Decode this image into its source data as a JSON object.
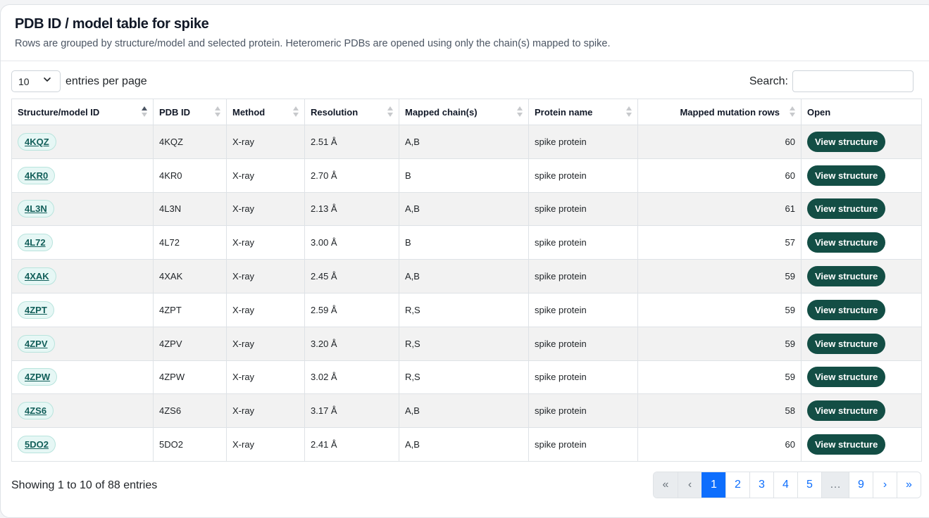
{
  "header": {
    "title": "PDB ID / model table for spike",
    "subtitle": "Rows are grouped by structure/model and selected protein. Heteromeric PDBs are opened using only the chain(s) mapped to spike."
  },
  "controls": {
    "length_value": "10",
    "length_label": "entries per page",
    "search_label": "Search:",
    "search_value": ""
  },
  "table": {
    "columns": [
      "Structure/model ID",
      "PDB ID",
      "Method",
      "Resolution",
      "Mapped chain(s)",
      "Protein name",
      "Mapped mutation rows",
      "Open"
    ],
    "sorted_column": "Structure/model ID",
    "sort_direction": "ascending",
    "rows": [
      {
        "id": "4KQZ",
        "pdb": "4KQZ",
        "method": "X-ray",
        "resolution": "2.51 Å",
        "chains": "A,B",
        "protein": "spike protein",
        "rows": "60",
        "open": "View structure"
      },
      {
        "id": "4KR0",
        "pdb": "4KR0",
        "method": "X-ray",
        "resolution": "2.70 Å",
        "chains": "B",
        "protein": "spike protein",
        "rows": "60",
        "open": "View structure"
      },
      {
        "id": "4L3N",
        "pdb": "4L3N",
        "method": "X-ray",
        "resolution": "2.13 Å",
        "chains": "A,B",
        "protein": "spike protein",
        "rows": "61",
        "open": "View structure"
      },
      {
        "id": "4L72",
        "pdb": "4L72",
        "method": "X-ray",
        "resolution": "3.00 Å",
        "chains": "B",
        "protein": "spike protein",
        "rows": "57",
        "open": "View structure"
      },
      {
        "id": "4XAK",
        "pdb": "4XAK",
        "method": "X-ray",
        "resolution": "2.45 Å",
        "chains": "A,B",
        "protein": "spike protein",
        "rows": "59",
        "open": "View structure"
      },
      {
        "id": "4ZPT",
        "pdb": "4ZPT",
        "method": "X-ray",
        "resolution": "2.59 Å",
        "chains": "R,S",
        "protein": "spike protein",
        "rows": "59",
        "open": "View structure"
      },
      {
        "id": "4ZPV",
        "pdb": "4ZPV",
        "method": "X-ray",
        "resolution": "3.20 Å",
        "chains": "R,S",
        "protein": "spike protein",
        "rows": "59",
        "open": "View structure"
      },
      {
        "id": "4ZPW",
        "pdb": "4ZPW",
        "method": "X-ray",
        "resolution": "3.02 Å",
        "chains": "R,S",
        "protein": "spike protein",
        "rows": "59",
        "open": "View structure"
      },
      {
        "id": "4ZS6",
        "pdb": "4ZS6",
        "method": "X-ray",
        "resolution": "3.17 Å",
        "chains": "A,B",
        "protein": "spike protein",
        "rows": "58",
        "open": "View structure"
      },
      {
        "id": "5DO2",
        "pdb": "5DO2",
        "method": "X-ray",
        "resolution": "2.41 Å",
        "chains": "A,B",
        "protein": "spike protein",
        "rows": "60",
        "open": "View structure"
      }
    ]
  },
  "footer": {
    "info": "Showing 1 to 10 of 88 entries",
    "pages": [
      {
        "label": "«",
        "state": "disabled"
      },
      {
        "label": "‹",
        "state": "disabled"
      },
      {
        "label": "1",
        "state": "active"
      },
      {
        "label": "2",
        "state": "normal"
      },
      {
        "label": "3",
        "state": "normal"
      },
      {
        "label": "4",
        "state": "normal"
      },
      {
        "label": "5",
        "state": "normal"
      },
      {
        "label": "…",
        "state": "disabled"
      },
      {
        "label": "9",
        "state": "normal"
      },
      {
        "label": "›",
        "state": "normal"
      },
      {
        "label": "»",
        "state": "normal"
      }
    ]
  },
  "colors": {
    "accent": "#134e45",
    "pill_bg": "#e6f7f5",
    "pager_active": "#0d6efd"
  },
  "icons": {
    "length_select": "chevron-down-icon",
    "sort": "sort-arrows-icon"
  }
}
